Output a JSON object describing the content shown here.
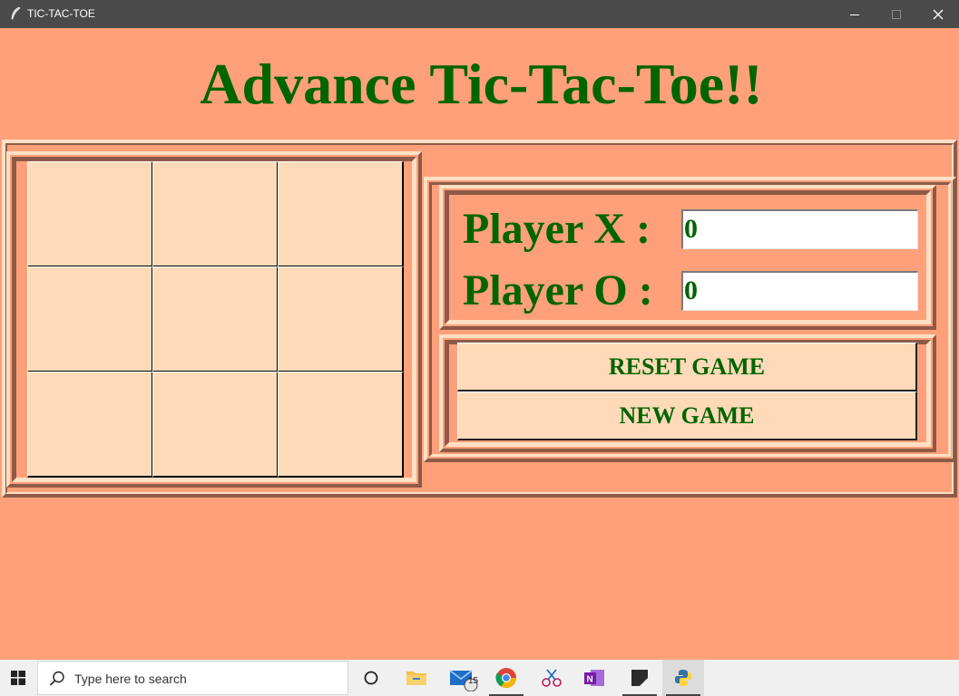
{
  "window": {
    "title": "TIC-TAC-TOE",
    "controls": [
      "minimize",
      "maximize",
      "close"
    ]
  },
  "app": {
    "heading": "Advance Tic-Tac-Toe!!",
    "board": {
      "cells": [
        "",
        "",
        "",
        "",
        "",
        "",
        "",
        "",
        ""
      ]
    },
    "score": {
      "player_x_label": "Player X :",
      "player_x_value": "0",
      "player_o_label": "Player O :",
      "player_o_value": "0"
    },
    "buttons": {
      "reset_label": "RESET GAME",
      "new_label": "NEW GAME"
    },
    "colors": {
      "background": "#ffa07a",
      "cell": "#ffdab9",
      "text": "#006400"
    }
  },
  "taskbar": {
    "search_placeholder": "Type here to search",
    "mail_badge": "15",
    "items": [
      "windows-start",
      "search",
      "task-view",
      "file-explorer",
      "mail",
      "chrome",
      "snip-sketch",
      "onenote",
      "sticky-notes",
      "python"
    ]
  }
}
